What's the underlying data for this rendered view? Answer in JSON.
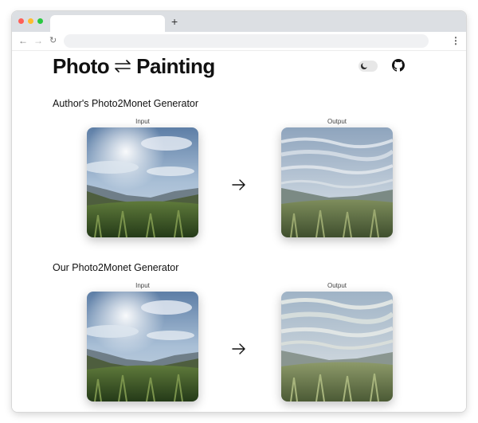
{
  "browser": {
    "new_tab_label": "+",
    "menu_label": "⋮",
    "back_label": "←",
    "forward_label": "→",
    "reload_label": "↻"
  },
  "header": {
    "title_left": "Photo",
    "title_icon": "swap-arrows-icon",
    "title_right": "Painting",
    "theme_toggle_icon": "moon-icon",
    "github_icon": "github-icon"
  },
  "sections": [
    {
      "title": "Author's Photo2Monet Generator",
      "input_label": "Input",
      "output_label": "Output",
      "arrow_icon": "arrow-right-icon"
    },
    {
      "title": "Our Photo2Monet Generator",
      "input_label": "Input",
      "output_label": "Output",
      "arrow_icon": "arrow-right-icon"
    }
  ]
}
